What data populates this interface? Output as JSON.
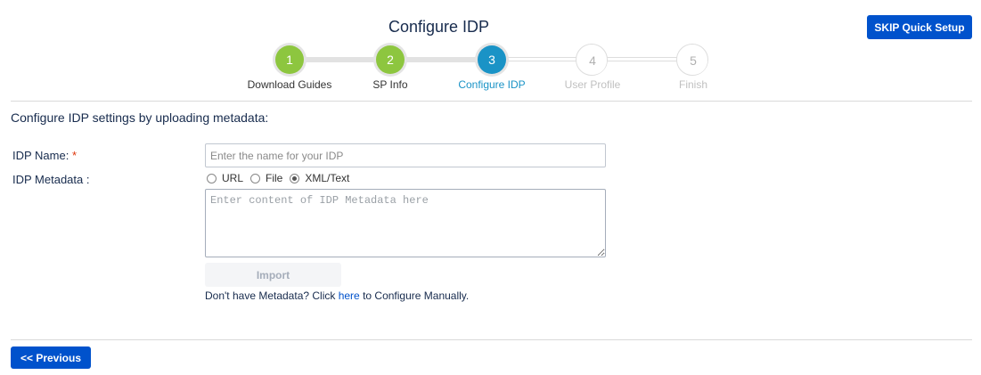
{
  "header": {
    "title": "Configure IDP",
    "skip_label": "SKIP Quick Setup"
  },
  "wizard": {
    "steps": [
      {
        "number": "1",
        "label": "Download Guides",
        "state": "done"
      },
      {
        "number": "2",
        "label": "SP Info",
        "state": "done"
      },
      {
        "number": "3",
        "label": "Configure IDP",
        "state": "active"
      },
      {
        "number": "4",
        "label": "User Profile",
        "state": "todo"
      },
      {
        "number": "5",
        "label": "Finish",
        "state": "todo"
      }
    ]
  },
  "form": {
    "heading": "Configure IDP settings by uploading metadata:",
    "idp_name_label": "IDP Name:",
    "required_marker": "*",
    "idp_name_placeholder": "Enter the name for your IDP",
    "idp_name_value": "",
    "metadata_label": "IDP Metadata :",
    "metadata_options": [
      {
        "label": "URL",
        "checked": false
      },
      {
        "label": "File",
        "checked": false
      },
      {
        "label": "XML/Text",
        "checked": true
      }
    ],
    "metadata_placeholder": "Enter content of IDP Metadata here",
    "metadata_value": "",
    "import_label": "Import",
    "help_prefix": "Don't have Metadata? Click ",
    "help_link": "here",
    "help_suffix": " to Configure Manually."
  },
  "footer": {
    "previous_label": "<< Previous"
  },
  "colors": {
    "primary": "#0052cc",
    "step_done": "#8dc63f",
    "step_active": "#1a93c6",
    "step_todo_text": "#c0c0c0",
    "required": "#de350b"
  }
}
